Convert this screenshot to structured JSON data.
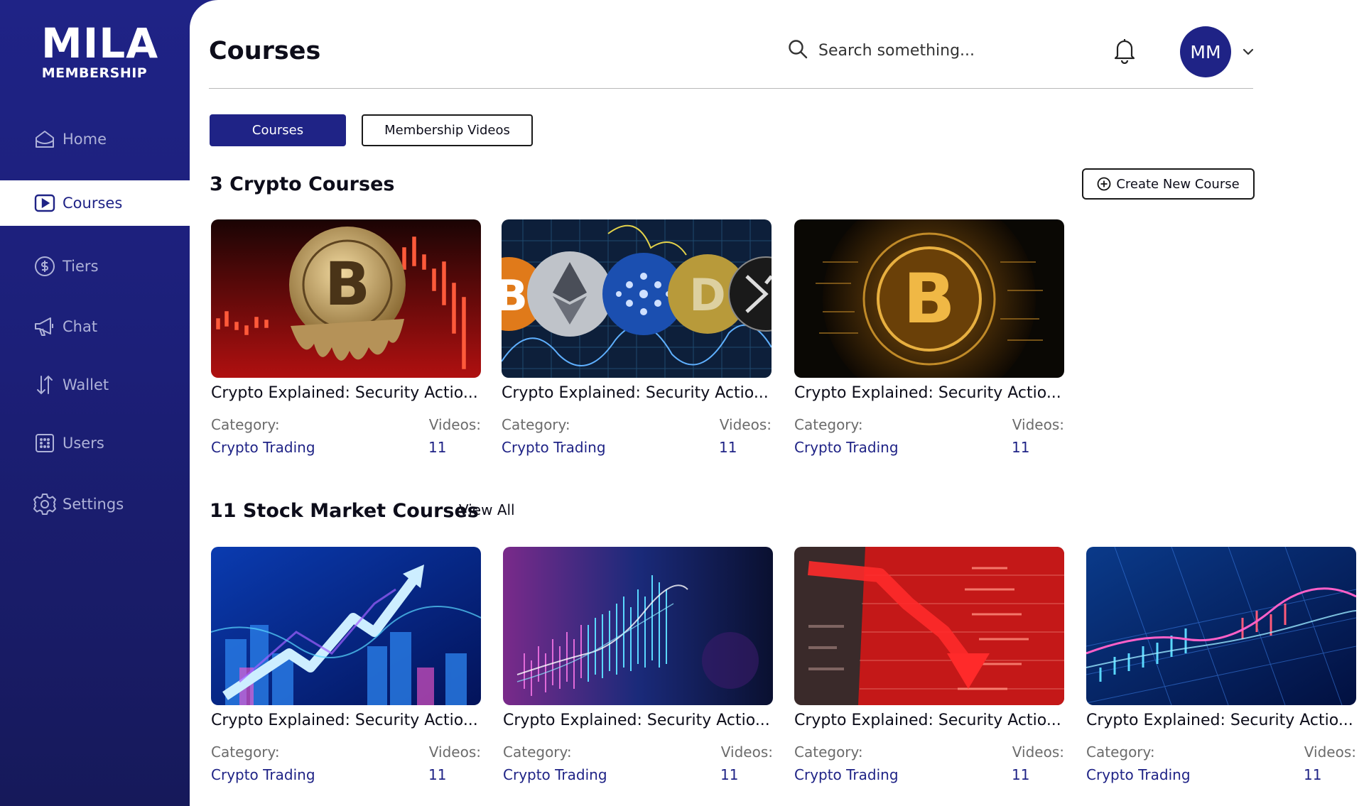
{
  "brand": {
    "logo_main": "MILA",
    "logo_sub": "MEMBERSHIP"
  },
  "sidebar": {
    "items": [
      {
        "label": "Home",
        "icon": "home-icon",
        "active": false
      },
      {
        "label": "Courses",
        "icon": "play-icon",
        "active": true
      },
      {
        "label": "Tiers",
        "icon": "dollar-icon",
        "active": false
      },
      {
        "label": "Chat",
        "icon": "megaphone-icon",
        "active": false
      },
      {
        "label": "Wallet",
        "icon": "transfer-arrows-icon",
        "active": false
      },
      {
        "label": "Users",
        "icon": "users-grid-icon",
        "active": false
      },
      {
        "label": "Settings",
        "icon": "gear-icon",
        "active": false
      }
    ]
  },
  "header": {
    "title": "Courses",
    "search_placeholder": "Search something...",
    "avatar_initials": "MM"
  },
  "tabs": [
    {
      "label": "Courses",
      "active": true
    },
    {
      "label": "Membership Videos",
      "active": false
    }
  ],
  "sections": {
    "crypto": {
      "title": "3 Crypto Courses",
      "action_label": "Create New Course",
      "courses": [
        {
          "title": "Crypto Explained: Security Actio...",
          "category_label": "Category:",
          "category": "Crypto Trading",
          "videos_label": "Videos:",
          "videos": "11"
        },
        {
          "title": "Crypto Explained: Security Actio...",
          "category_label": "Category:",
          "category": "Crypto Trading",
          "videos_label": "Videos:",
          "videos": "11"
        },
        {
          "title": "Crypto Explained: Security Actio...",
          "category_label": "Category:",
          "category": "Crypto Trading",
          "videos_label": "Videos:",
          "videos": "11"
        }
      ]
    },
    "stock": {
      "title": "11 Stock Market Courses",
      "view_all_label": "View All",
      "courses": [
        {
          "title": "Crypto Explained: Security Actio...",
          "category_label": "Category:",
          "category": "Crypto Trading",
          "videos_label": "Videos:",
          "videos": "11"
        },
        {
          "title": "Crypto Explained: Security Actio...",
          "category_label": "Category:",
          "category": "Crypto Trading",
          "videos_label": "Videos:",
          "videos": "11"
        },
        {
          "title": "Crypto Explained: Security Actio...",
          "category_label": "Category:",
          "category": "Crypto Trading",
          "videos_label": "Videos:",
          "videos": "11"
        },
        {
          "title": "Crypto Explained: Security Actio...",
          "category_label": "Category:",
          "category": "Crypto Trading",
          "videos_label": "Videos:",
          "videos": "11"
        }
      ]
    }
  },
  "colors": {
    "primary": "#1f2386",
    "sidebar_text": "#aeb2d8",
    "link": "#1f2386"
  }
}
